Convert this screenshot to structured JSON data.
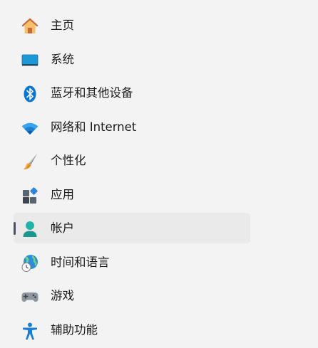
{
  "sidebar": {
    "items": [
      {
        "id": "home",
        "label": "主页",
        "icon": "home-icon"
      },
      {
        "id": "system",
        "label": "系统",
        "icon": "display-icon"
      },
      {
        "id": "bluetooth",
        "label": "蓝牙和其他设备",
        "icon": "bluetooth-icon"
      },
      {
        "id": "network",
        "label": "网络和 Internet",
        "icon": "wifi-icon"
      },
      {
        "id": "personalization",
        "label": "个性化",
        "icon": "brush-icon"
      },
      {
        "id": "apps",
        "label": "应用",
        "icon": "apps-icon"
      },
      {
        "id": "accounts",
        "label": "帐户",
        "icon": "person-icon",
        "selected": true
      },
      {
        "id": "time-language",
        "label": "时间和语言",
        "icon": "globe-clock-icon"
      },
      {
        "id": "gaming",
        "label": "游戏",
        "icon": "gamepad-icon"
      },
      {
        "id": "accessibility",
        "label": "辅助功能",
        "icon": "accessibility-icon"
      }
    ]
  },
  "colors": {
    "background": "#f3f3f3",
    "selected_background": "#eaeaea",
    "indicator": "#43516a",
    "accent_blue": "#0078d4",
    "teal": "#20b2a6"
  }
}
